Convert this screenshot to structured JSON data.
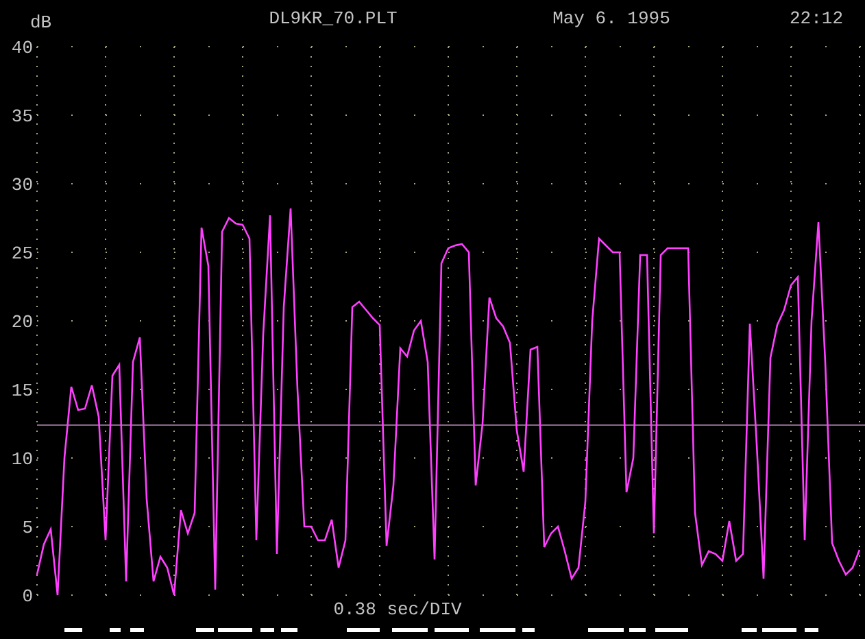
{
  "header": {
    "file": "DL9KR_70.PLT",
    "date": "May  6. 1995",
    "time": "22:12"
  },
  "plot": {
    "chart_data": {
      "type": "line",
      "ylabel": "dB",
      "xlabel": "0.38 sec/DIV",
      "ylim": [
        0,
        40
      ],
      "grid": true,
      "yticks": [
        0,
        5,
        10,
        15,
        20,
        25,
        30,
        35,
        40
      ],
      "categories": [
        null,
        null,
        null,
        null,
        null,
        null,
        null,
        null,
        null,
        null,
        null,
        null,
        null,
        null,
        null,
        null,
        null,
        null,
        null,
        null,
        null,
        null,
        null,
        null,
        null,
        null,
        null,
        null,
        null,
        null,
        null,
        null,
        null,
        null,
        null,
        null,
        null,
        null,
        null,
        null,
        null,
        null,
        null,
        null,
        null,
        null,
        null,
        null,
        null,
        null,
        null,
        null,
        null,
        null,
        null,
        null,
        null,
        null,
        null,
        null,
        null,
        null,
        null,
        null,
        null,
        null,
        null,
        null,
        null,
        null,
        null,
        null,
        null,
        null,
        null,
        null,
        null,
        null,
        null,
        null,
        null,
        null,
        null,
        null,
        null,
        null,
        null,
        null,
        null,
        null,
        null,
        null,
        null,
        null,
        null,
        null,
        null,
        null,
        null,
        null,
        null,
        null,
        null,
        null,
        null,
        null,
        null,
        null,
        null,
        null,
        null,
        null,
        null,
        null,
        null,
        null,
        null,
        null,
        null,
        null,
        null
      ],
      "series": [
        {
          "color": "#ff40ff",
          "values": [
            1.5,
            3.7,
            4.8,
            0,
            10,
            15.2,
            13.5,
            13.6,
            15.3,
            13,
            4,
            16,
            16.8,
            1,
            17,
            18.8,
            7,
            1,
            2.8,
            2,
            0,
            6.2,
            4.5,
            6,
            26.8,
            24,
            0.4,
            26.5,
            27.5,
            27.1,
            27,
            26,
            4,
            19,
            27.7,
            3,
            21,
            28.2,
            15,
            5,
            5,
            4,
            4,
            5.5,
            2,
            4,
            21,
            21.4,
            20.8,
            20.2,
            19.7,
            3.6,
            8,
            18,
            17.4,
            19.3,
            20,
            17,
            2.6,
            24.2,
            25.3,
            25.5,
            25.6,
            25,
            8,
            12.5,
            21.7,
            20.2,
            19.6,
            18.4,
            12,
            9,
            17.9,
            18.1,
            3.5,
            4.5,
            5,
            3.2,
            1.2,
            2,
            6.8,
            20,
            26,
            25.5,
            25,
            25,
            7.5,
            10,
            24.8,
            24.8,
            4.5,
            24.8,
            25.3,
            25.3,
            25.3,
            25.3,
            6,
            2.2,
            3.2,
            3,
            2.5,
            5.4,
            2.5,
            3,
            19.8,
            11,
            1.2,
            17.3,
            19.7,
            20.8,
            22.6,
            23.2,
            4,
            20,
            27.2,
            17,
            3.8,
            2.5,
            1.5,
            2,
            3.3
          ]
        }
      ],
      "ref_lines": [
        {
          "axis": "y",
          "value": 12.4
        }
      ]
    }
  }
}
